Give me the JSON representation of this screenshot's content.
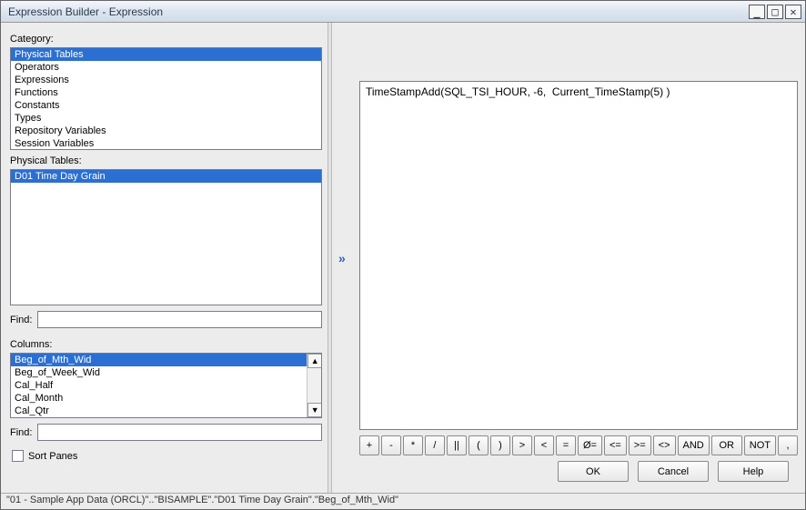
{
  "window": {
    "title": "Expression Builder - Expression"
  },
  "left": {
    "category_label": "Category:",
    "categories": [
      "Physical Tables",
      "Operators",
      "Expressions",
      "Functions",
      "Constants",
      "Types",
      "Repository Variables",
      "Session Variables"
    ],
    "category_selected_index": 0,
    "physical_label": "Physical Tables:",
    "physical_tables": [
      "D01 Time Day Grain"
    ],
    "physical_selected_index": 0,
    "columns_label": "Columns:",
    "columns": [
      "Beg_of_Mth_Wid",
      "Beg_of_Week_Wid",
      "Cal_Half",
      "Cal_Month",
      "Cal_Qtr"
    ],
    "columns_selected_index": 0,
    "find_label": "Find:",
    "find1_value": "",
    "find2_value": "",
    "sort_panes_label": "Sort Panes"
  },
  "right": {
    "expression_text": "TimeStampAdd(SQL_TSI_HOUR, -6,  Current_TimeStamp(5) )"
  },
  "operators": [
    "+",
    "-",
    "*",
    "/",
    "||",
    "(",
    ")",
    ">",
    "<",
    "=",
    "Ø=",
    "<=",
    ">=",
    "<>",
    "AND",
    "OR",
    "NOT",
    ","
  ],
  "buttons": {
    "ok": "OK",
    "cancel": "Cancel",
    "help": "Help"
  },
  "status": "\"01 - Sample App Data (ORCL)\"..\"BISAMPLE\".\"D01 Time Day Grain\".\"Beg_of_Mth_Wid\""
}
